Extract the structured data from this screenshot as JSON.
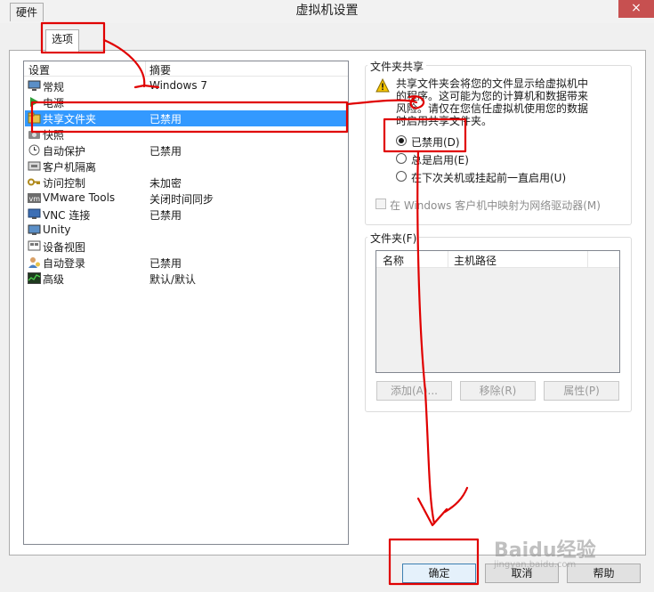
{
  "window": {
    "title": "虚拟机设置",
    "close_glyph": "×"
  },
  "tabs": [
    {
      "label": "硬件",
      "active": false
    },
    {
      "label": "选项",
      "active": true
    }
  ],
  "settings_list": {
    "headers": {
      "setting": "设置",
      "summary": "摘要"
    },
    "rows": [
      {
        "name": "常规",
        "summary": "Windows 7",
        "icon": "monitor-icon",
        "selected": false
      },
      {
        "name": "电源",
        "summary": "",
        "icon": "power-play-icon",
        "selected": false
      },
      {
        "name": "共享文件夹",
        "summary": "已禁用",
        "icon": "shared-folder-icon",
        "selected": true
      },
      {
        "name": "快照",
        "summary": "",
        "icon": "snapshot-icon",
        "selected": false
      },
      {
        "name": "自动保护",
        "summary": "已禁用",
        "icon": "clock-icon",
        "selected": false
      },
      {
        "name": "客户机隔离",
        "summary": "",
        "icon": "isolation-icon",
        "selected": false
      },
      {
        "name": "访问控制",
        "summary": "未加密",
        "icon": "key-icon",
        "selected": false
      },
      {
        "name": "VMware Tools",
        "summary": "关闭时间同步",
        "icon": "vm-icon",
        "selected": false
      },
      {
        "name": "VNC 连接",
        "summary": "已禁用",
        "icon": "vnc-icon",
        "selected": false
      },
      {
        "name": "Unity",
        "summary": "",
        "icon": "unity-icon",
        "selected": false
      },
      {
        "name": "设备视图",
        "summary": "",
        "icon": "device-view-icon",
        "selected": false
      },
      {
        "name": "自动登录",
        "summary": "已禁用",
        "icon": "user-icon",
        "selected": false
      },
      {
        "name": "高级",
        "summary": "默认/默认",
        "icon": "chart-icon",
        "selected": false
      }
    ]
  },
  "folder_sharing": {
    "group_label": "文件夹共享",
    "warning_lines": [
      "共享文件夹会将您的文件显示给虚拟机中",
      "的程序。这可能为您的计算机和数据带来",
      "风险。请仅在您信任虚拟机使用您的数据",
      "时启用共享文件夹。"
    ],
    "options": [
      {
        "label": "已禁用(D)",
        "checked": true
      },
      {
        "label": "总是启用(E)",
        "checked": false
      },
      {
        "label": "在下次关机或挂起前一直启用(U)",
        "checked": false
      }
    ],
    "map_drive_label": "在 Windows 客户机中映射为网络驱动器(M)"
  },
  "folders": {
    "group_label": "文件夹(F)",
    "columns": [
      "名称",
      "主机路径"
    ],
    "buttons": {
      "add": "添加(A)...",
      "remove": "移除(R)",
      "properties": "属性(P)"
    }
  },
  "footer": {
    "ok": "确定",
    "cancel": "取消",
    "help": "帮助"
  },
  "watermark": {
    "text": "Baidu经验",
    "sub": "jingyan.baidu.com"
  },
  "colors": {
    "selection": "#3399ff",
    "annotation": "#e00000"
  }
}
